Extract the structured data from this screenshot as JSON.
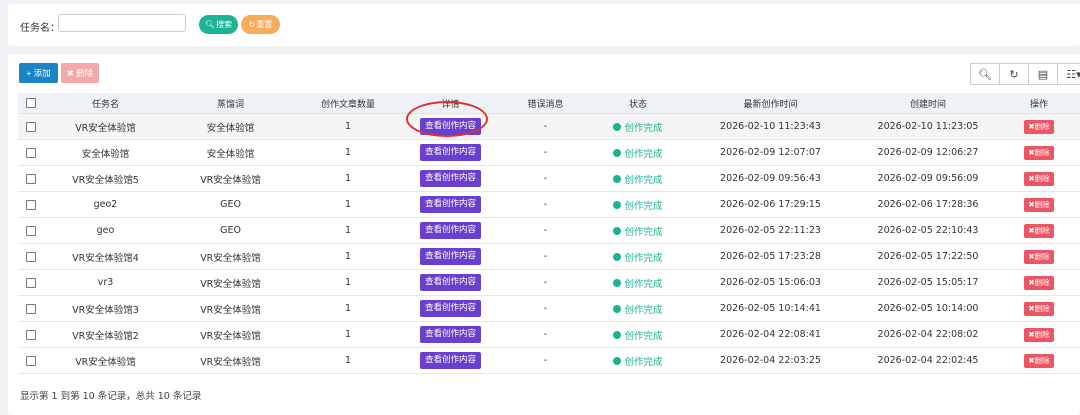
{
  "search": {
    "label": "任务名：",
    "input_value": "",
    "input_placeholder": "",
    "search_label": "搜索",
    "reset_label": "重置"
  },
  "toolbar": {
    "add_label": "添加",
    "delete_label": "删除",
    "tools": [
      "search-icon",
      "refresh-icon",
      "columns-icon",
      "export-icon"
    ]
  },
  "table": {
    "headers": [
      "",
      "任务名",
      "蒸馏词",
      "创作文章数量",
      "详情",
      "错误消息",
      "状态",
      "最新创作时间",
      "创建时间",
      "操作"
    ],
    "rows": [
      {
        "name": "VR安全体验馆",
        "keyword": "安全体验馆",
        "count": "1",
        "detail": "查看创作内容",
        "error": "-",
        "status": "创作完成",
        "latest": "2026-02-10 11:23:43",
        "created": "2026-02-10 11:23:05",
        "op": "删除"
      },
      {
        "name": "安全体验馆",
        "keyword": "安全体验馆",
        "count": "1",
        "detail": "查看创作内容",
        "error": "-",
        "status": "创作完成",
        "latest": "2026-02-09 12:07:07",
        "created": "2026-02-09 12:06:27",
        "op": "删除"
      },
      {
        "name": "VR安全体验馆5",
        "keyword": "VR安全体验馆",
        "count": "1",
        "detail": "查看创作内容",
        "error": "-",
        "status": "创作完成",
        "latest": "2026-02-09 09:56:43",
        "created": "2026-02-09 09:56:09",
        "op": "删除"
      },
      {
        "name": "geo2",
        "keyword": "GEO",
        "count": "1",
        "detail": "查看创作内容",
        "error": "-",
        "status": "创作完成",
        "latest": "2026-02-06 17:29:15",
        "created": "2026-02-06 17:28:36",
        "op": "删除"
      },
      {
        "name": "geo",
        "keyword": "GEO",
        "count": "1",
        "detail": "查看创作内容",
        "error": "-",
        "status": "创作完成",
        "latest": "2026-02-05 22:11:23",
        "created": "2026-02-05 22:10:43",
        "op": "删除"
      },
      {
        "name": "VR安全体验馆4",
        "keyword": "VR安全体验馆",
        "count": "1",
        "detail": "查看创作内容",
        "error": "-",
        "status": "创作完成",
        "latest": "2026-02-05 17:23:28",
        "created": "2026-02-05 17:22:50",
        "op": "删除"
      },
      {
        "name": "vr3",
        "keyword": "VR安全体验馆",
        "count": "1",
        "detail": "查看创作内容",
        "error": "-",
        "status": "创作完成",
        "latest": "2026-02-05 15:06:03",
        "created": "2026-02-05 15:05:17",
        "op": "删除"
      },
      {
        "name": "VR安全体验馆3",
        "keyword": "VR安全体验馆",
        "count": "1",
        "detail": "查看创作内容",
        "error": "-",
        "status": "创作完成",
        "latest": "2026-02-05 10:14:41",
        "created": "2026-02-05 10:14:00",
        "op": "删除"
      },
      {
        "name": "VR安全体验馆2",
        "keyword": "VR安全体验馆",
        "count": "1",
        "detail": "查看创作内容",
        "error": "-",
        "status": "创作完成",
        "latest": "2026-02-04 22:08:41",
        "created": "2026-02-04 22:08:02",
        "op": "删除"
      },
      {
        "name": "VR安全体验馆",
        "keyword": "VR安全体验馆",
        "count": "1",
        "detail": "查看创作内容",
        "error": "-",
        "status": "创作完成",
        "latest": "2026-02-04 22:03:25",
        "created": "2026-02-04 22:02:45",
        "op": "删除"
      }
    ]
  },
  "footer": {
    "summary": "显示第 1 到第 10 条记录，总共 10 条记录"
  },
  "colors": {
    "primary_blue": "#1c84c6",
    "success_green": "#1ab394",
    "warning_orange": "#f8ac59",
    "danger_red": "#ed5565",
    "detail_purple": "#6a3fcf",
    "annotation_red": "#e03030"
  }
}
